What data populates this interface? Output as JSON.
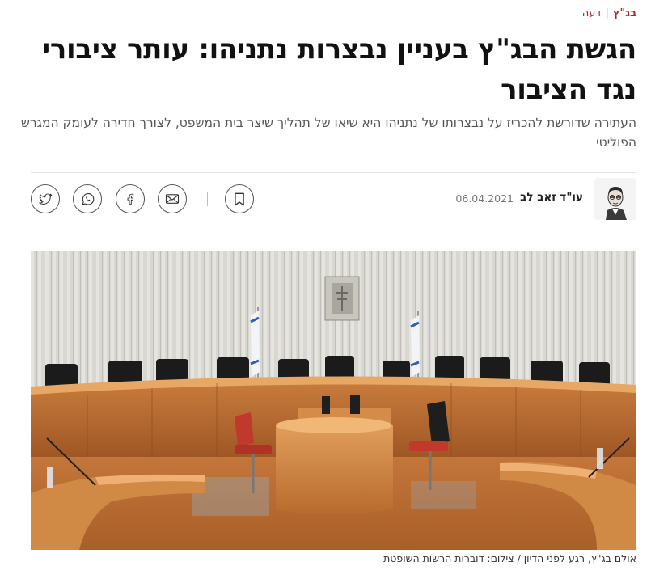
{
  "breadcrumb": {
    "section": "בג\"ץ",
    "separator": "|",
    "subsection": "דעה"
  },
  "article": {
    "headline": "הגשת הבג\"ץ בעניין נבצרות נתניהו: עותר ציבורי נגד הציבור",
    "subtitle": "העתירה שדורשת להכריז על נבצרותו של נתניהו היא שיאו של תהליך שיצר בית המשפט, לצורך חדירה לעומק המגרש הפוליטי",
    "author": "עו\"ד זאב לב",
    "date": "06.04.2021"
  },
  "share": {
    "icons": [
      "twitter-icon",
      "whatsapp-icon",
      "facebook-icon",
      "email-icon",
      "bookmark-icon"
    ]
  },
  "image": {
    "caption": "אולם בג\"ץ, רגע לפני הדיון / צילום: דוברות הרשות השופטת"
  }
}
